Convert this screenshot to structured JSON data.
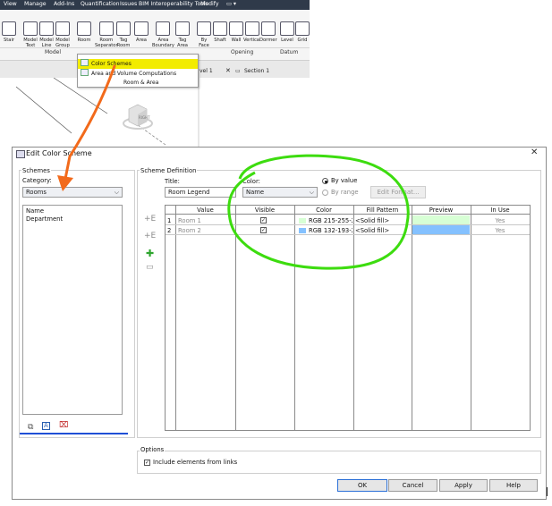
{
  "ribbon": {
    "tabs": [
      "View",
      "Manage",
      "Add-Ins",
      "Quantification",
      "Issues",
      "BIM Interoperability Tools",
      "Modify",
      "▭ ▾"
    ],
    "tools": [
      {
        "label": "Stair",
        "icon": "stair-icon"
      },
      {
        "label": "Model\nText",
        "icon": "model-text-icon"
      },
      {
        "label": "Model\nLine",
        "icon": "model-line-icon"
      },
      {
        "label": "Model\nGroup",
        "icon": "model-group-icon"
      },
      {
        "label": "Room",
        "icon": "room-icon"
      },
      {
        "label": "Room\nSeparator",
        "icon": "room-separator-icon"
      },
      {
        "label": "Tag\nRoom",
        "icon": "tag-room-icon"
      },
      {
        "label": "Area",
        "icon": "area-icon"
      },
      {
        "label": "Area\nBoundary",
        "icon": "area-boundary-icon"
      },
      {
        "label": "Tag\nArea",
        "icon": "tag-area-icon"
      },
      {
        "label": "By\nFace",
        "icon": "by-face-icon"
      },
      {
        "label": "Shaft",
        "icon": "shaft-icon"
      },
      {
        "label": "Wall",
        "icon": "wall-opening-icon"
      },
      {
        "label": "Vertical",
        "icon": "vertical-opening-icon"
      },
      {
        "label": "Dormer",
        "icon": "dormer-icon"
      },
      {
        "label": "Level",
        "icon": "level-icon"
      },
      {
        "label": "Grid",
        "icon": "grid-icon"
      }
    ],
    "panels": [
      "Model",
      "Opening",
      "Datum"
    ],
    "view_tabs": [
      "vel 1",
      "Section 1"
    ]
  },
  "menu": {
    "items": [
      {
        "label": "Color Schemes",
        "highlighted": true
      },
      {
        "label": "Area and Volume Computations",
        "highlighted": false
      },
      {
        "label": "Room & Area",
        "highlighted": false
      }
    ]
  },
  "cube": {
    "face": "RIGHT"
  },
  "dialog": {
    "title": "Edit Color Scheme",
    "close": "✕",
    "schemes": {
      "group": "Schemes",
      "category_label": "Category:",
      "category_value": "Rooms",
      "items": [
        "Name",
        "Department"
      ]
    },
    "definition": {
      "group": "Scheme Definition",
      "title_label": "Title:",
      "title_value": "Room Legend",
      "color_label": "Color:",
      "color_value": "Name",
      "by_value": "By value",
      "by_range": "By range",
      "edit_format": "Edit Format...",
      "columns": [
        "Value",
        "Visible",
        "Color",
        "Fill Pattern",
        "Preview",
        "In Use"
      ],
      "rows": [
        {
          "num": "1",
          "value": "Room 1",
          "visible": true,
          "color": "RGB 215-255-21",
          "swatch": "#d7ffd5",
          "pattern": "<Solid fill>",
          "preview": "#d7ffd5",
          "in_use": "Yes"
        },
        {
          "num": "2",
          "value": "Room 2",
          "visible": true,
          "color": "RGB 132-193-25",
          "swatch": "#84c1ff",
          "pattern": "<Solid fill>",
          "preview": "#84c1ff",
          "in_use": "Yes"
        }
      ]
    },
    "options": {
      "group": "Options",
      "include_links": "Include elements from links",
      "include_links_checked": true
    },
    "buttons": {
      "ok": "OK",
      "cancel": "Cancel",
      "apply": "Apply",
      "help": "Help"
    }
  },
  "colors": {
    "annotation_green": "#3ddc0f",
    "annotation_orange": "#f26a1b",
    "annotation_blue": "#1f4fd6",
    "menu_highlight": "#f2ec00"
  }
}
